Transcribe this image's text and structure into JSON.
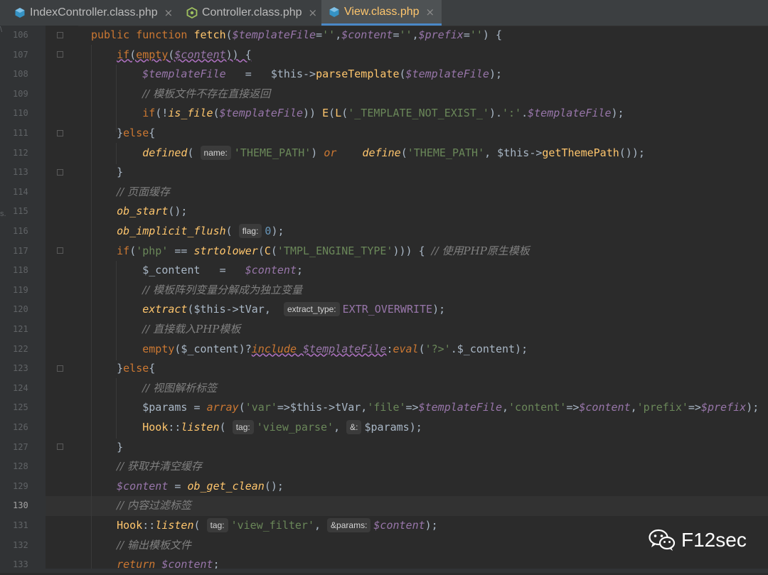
{
  "tabs": [
    {
      "label": "IndexController.class.php",
      "close": "×",
      "icon": "php-class-icon",
      "active": false
    },
    {
      "label": "Controller.class.php",
      "close": "×",
      "icon": "php-class-icon",
      "active": false
    },
    {
      "label": "View.class.php",
      "close": "×",
      "icon": "php-class-icon",
      "active": true
    }
  ],
  "editor": {
    "current_line": "130",
    "line_numbers": [
      "106",
      "107",
      "108",
      "109",
      "110",
      "111",
      "112",
      "113",
      "114",
      "115",
      "116",
      "117",
      "118",
      "119",
      "120",
      "121",
      "122",
      "123",
      "124",
      "125",
      "126",
      "127",
      "128",
      "129",
      "130",
      "131",
      "132",
      "133"
    ]
  },
  "hints": {
    "name": "name:",
    "flag": "flag:",
    "extract_type": "extract_type:",
    "tag1": "tag:",
    "amp": "&:",
    "tag2": "tag:",
    "params": "&params:"
  },
  "comments": {
    "c109": "// 模板文件不存在直接返回",
    "c114": "// 页面缓存",
    "c117": "// 使用PHP原生模板",
    "c119": "// 模板阵列变量分解成为独立变量",
    "c121": "// 直接载入PHP模板",
    "c124": "// 视图解析标签",
    "c128": "// 获取并清空缓存",
    "c130": "// 内容过滤标签",
    "c132": "// 输出模板文件"
  },
  "watermark": {
    "text": "F12sec",
    "icon": "wechat-icon"
  },
  "side_fragments": {
    "top": "\\",
    "mid": "s."
  },
  "colors": {
    "background": "#2b2b2b",
    "keyword": "#cc7832",
    "function": "#ffc66d",
    "variable": "#9876aa",
    "string": "#6a8759",
    "comment": "#808080"
  }
}
